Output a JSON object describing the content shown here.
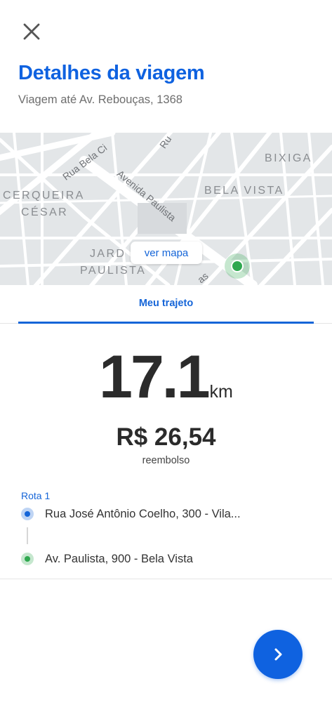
{
  "header": {
    "close_icon": "close-icon",
    "title": "Detalhes da viagem",
    "subtitle": "Viagem até Av. Rebouças, 1368"
  },
  "map": {
    "neighborhoods": {
      "cerqueira_1": "CERQUEIRA",
      "cerqueira_2": "CÉSAR",
      "jardim_1": "JARD",
      "jardim_2": "PAULISTA",
      "bixiga": "BIXIGA",
      "bela_vista": "BELA VISTA"
    },
    "streets": {
      "rua_bela_cintra": "Rua Bela Ci",
      "avenida_paulista": "Avenida Paulista",
      "rua_top": "Ru",
      "bottom_street": "as"
    },
    "ver_mapa_label": "ver mapa",
    "pin_color": "#2fa84f"
  },
  "tabs": {
    "active_label": "Meu trajeto"
  },
  "summary": {
    "distance_value": "17.1",
    "distance_unit": "km",
    "price": "R$ 26,54",
    "price_caption": "reembolso"
  },
  "route": {
    "label": "Rota 1",
    "origin": "Rua José Antônio Coelho, 300 - Vila...",
    "destination": "Av. Paulista, 900 - Bela Vista",
    "origin_color": "#1565d8",
    "destination_color": "#2fa84f"
  },
  "actions": {
    "next_icon": "chevron-right-icon"
  },
  "colors": {
    "accent": "#0f62e0",
    "text": "#2b2b2b"
  }
}
